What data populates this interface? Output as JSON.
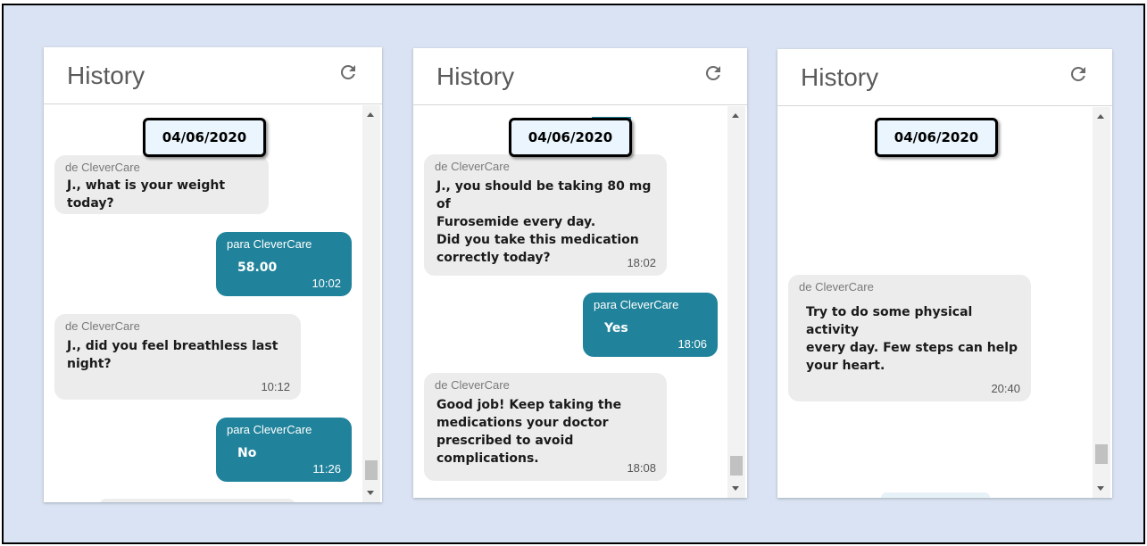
{
  "panels": [
    {
      "title": "History",
      "date": "04/06/2020",
      "messages": [
        {
          "sender": "de CleverCare",
          "text": "J., what is your weight today?",
          "time": ""
        },
        {
          "sender": "para CleverCare",
          "text": "58.00",
          "time": "10:02"
        },
        {
          "sender": "de CleverCare",
          "text": "J., did you feel breathless last\nnight?",
          "time": "10:12"
        },
        {
          "sender": "para CleverCare",
          "text": "No",
          "time": "11:26"
        }
      ]
    },
    {
      "title": "History",
      "date": "04/06/2020",
      "messages": [
        {
          "sender": "de CleverCare",
          "text": " J., you should be taking 80 mg of\nFurosemide every day.\nDid you take this medication\ncorrectly today?",
          "time": "18:02"
        },
        {
          "sender": "para CleverCare",
          "text": "Yes",
          "time": "18:06"
        },
        {
          "sender": "de CleverCare",
          "text": "Good job! Keep taking the\nmedications your doctor\nprescribed to avoid complications.",
          "time": "18:08"
        }
      ]
    },
    {
      "title": "History",
      "date": "04/06/2020",
      "messages": [
        {
          "sender": "de CleverCare",
          "text": "Try to do some physical activity\nevery day. Few steps can help\nyour heart.",
          "time": "20:40"
        }
      ]
    }
  ],
  "icons": {
    "refresh": "refresh-icon",
    "scroll_up": "scroll-up-arrow-icon",
    "scroll_down": "scroll-down-arrow-icon"
  },
  "colors": {
    "background": "#dae3f3",
    "outgoing_bubble": "#21839b",
    "incoming_bubble": "#ececec",
    "date_badge": "#eaf5fd"
  }
}
